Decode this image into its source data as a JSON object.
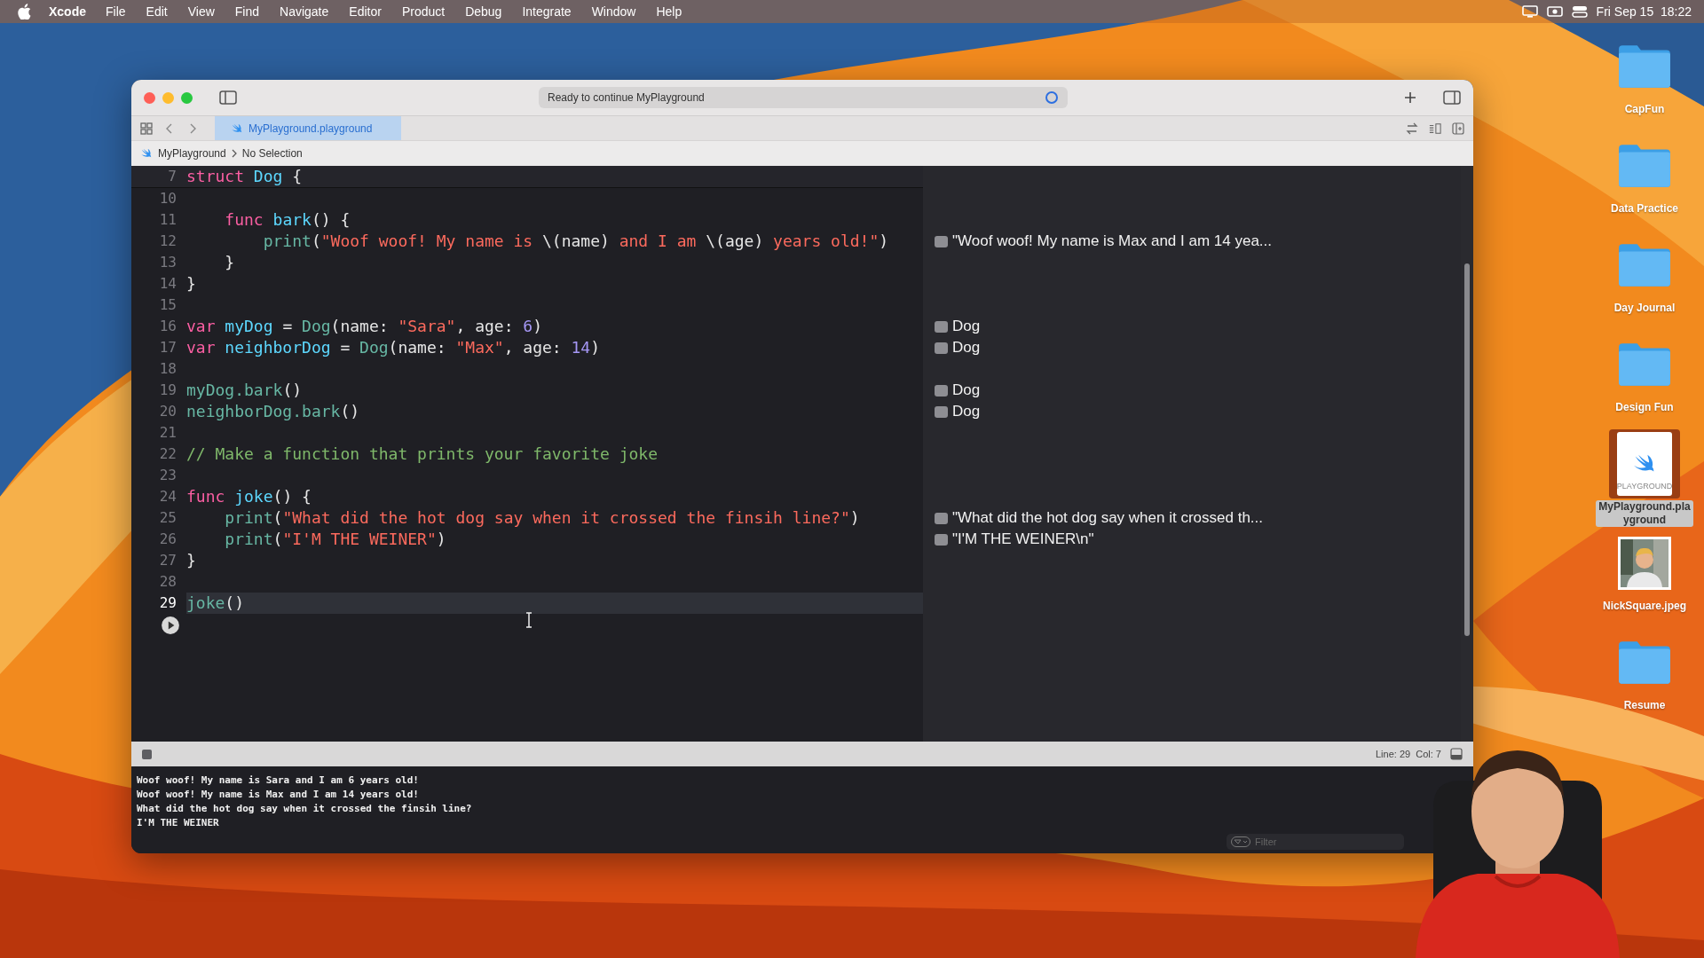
{
  "menu_bar": {
    "app_name": "Xcode",
    "menus": [
      "File",
      "Edit",
      "View",
      "Find",
      "Navigate",
      "Editor",
      "Product",
      "Debug",
      "Integrate",
      "Window",
      "Help"
    ],
    "clock": "Fri Sep 15  18:22"
  },
  "window": {
    "status": "Ready to continue MyPlayground",
    "tabs": [
      {
        "label": "MyPlayground.playground",
        "selected": true
      }
    ],
    "breadcrumb": [
      "MyPlayground",
      "No Selection"
    ],
    "sticky_line": {
      "number": "7",
      "tokens": [
        {
          "kind": "keyword",
          "text": "struct"
        },
        {
          "kind": "decl",
          "text": " Dog"
        },
        {
          "kind": "plain",
          "text": " {"
        }
      ]
    },
    "lines": [
      {
        "number": "10",
        "current": false
      },
      {
        "number": "11",
        "current": false,
        "tokens": [
          {
            "kind": "keyword",
            "text": "    func"
          },
          {
            "kind": "decl",
            "text": " bark"
          },
          {
            "kind": "plain",
            "text": "() {"
          }
        ]
      },
      {
        "number": "12",
        "current": false,
        "result": "\"Woof woof! My name is Max and I am 14 yea...",
        "tokens": [
          {
            "kind": "call",
            "text": "        print"
          },
          {
            "kind": "plain",
            "text": "("
          },
          {
            "kind": "string",
            "text": "\"Woof woof! My name is "
          },
          {
            "kind": "plain",
            "text": "\\(name)"
          },
          {
            "kind": "string",
            "text": " and I am "
          },
          {
            "kind": "plain",
            "text": "\\(age)"
          },
          {
            "kind": "string",
            "text": " years old!\""
          },
          {
            "kind": "plain",
            "text": ")"
          }
        ]
      },
      {
        "number": "13",
        "current": false,
        "tokens": [
          {
            "kind": "plain",
            "text": "    }"
          }
        ]
      },
      {
        "number": "14",
        "current": false,
        "tokens": [
          {
            "kind": "plain",
            "text": "}"
          }
        ]
      },
      {
        "number": "15",
        "current": false
      },
      {
        "number": "16",
        "current": false,
        "result": "Dog",
        "tokens": [
          {
            "kind": "keyword",
            "text": "var"
          },
          {
            "kind": "decl",
            "text": " myDog"
          },
          {
            "kind": "plain",
            "text": " = "
          },
          {
            "kind": "call",
            "text": "Dog"
          },
          {
            "kind": "plain",
            "text": "(name: "
          },
          {
            "kind": "string",
            "text": "\"Sara\""
          },
          {
            "kind": "plain",
            "text": ", age: "
          },
          {
            "kind": "number",
            "text": "6"
          },
          {
            "kind": "plain",
            "text": ")"
          }
        ]
      },
      {
        "number": "17",
        "current": false,
        "result": "Dog",
        "tokens": [
          {
            "kind": "keyword",
            "text": "var"
          },
          {
            "kind": "decl",
            "text": " neighborDog"
          },
          {
            "kind": "plain",
            "text": " = "
          },
          {
            "kind": "call",
            "text": "Dog"
          },
          {
            "kind": "plain",
            "text": "(name: "
          },
          {
            "kind": "string",
            "text": "\"Max\""
          },
          {
            "kind": "plain",
            "text": ", age: "
          },
          {
            "kind": "number",
            "text": "14"
          },
          {
            "kind": "plain",
            "text": ")"
          }
        ]
      },
      {
        "number": "18",
        "current": false
      },
      {
        "number": "19",
        "current": false,
        "result": "Dog",
        "tokens": [
          {
            "kind": "call",
            "text": "myDog.bark"
          },
          {
            "kind": "plain",
            "text": "()"
          }
        ]
      },
      {
        "number": "20",
        "current": false,
        "result": "Dog",
        "tokens": [
          {
            "kind": "call",
            "text": "neighborDog.bark"
          },
          {
            "kind": "plain",
            "text": "()"
          }
        ]
      },
      {
        "number": "21",
        "current": false
      },
      {
        "number": "22",
        "current": false,
        "tokens": [
          {
            "kind": "comment",
            "text": "// Make a function that prints your favorite joke"
          }
        ]
      },
      {
        "number": "23",
        "current": false
      },
      {
        "number": "24",
        "current": false,
        "tokens": [
          {
            "kind": "keyword",
            "text": "func"
          },
          {
            "kind": "decl",
            "text": " joke"
          },
          {
            "kind": "plain",
            "text": "() {"
          }
        ]
      },
      {
        "number": "25",
        "current": false,
        "result": "\"What did the hot dog say when it crossed th...",
        "tokens": [
          {
            "kind": "call",
            "text": "    print"
          },
          {
            "kind": "plain",
            "text": "("
          },
          {
            "kind": "string",
            "text": "\"What did the hot dog say when it crossed the finsih line?\""
          },
          {
            "kind": "plain",
            "text": ")"
          }
        ]
      },
      {
        "number": "26",
        "current": false,
        "result": "\"I'M THE WEINER\\n\"",
        "tokens": [
          {
            "kind": "call",
            "text": "    print"
          },
          {
            "kind": "plain",
            "text": "("
          },
          {
            "kind": "string",
            "text": "\"I'M THE WEINER\""
          },
          {
            "kind": "plain",
            "text": ")"
          }
        ]
      },
      {
        "number": "27",
        "current": false,
        "tokens": [
          {
            "kind": "plain",
            "text": "}"
          }
        ]
      },
      {
        "number": "28",
        "current": false
      },
      {
        "number": "29",
        "current": true,
        "tokens": [
          {
            "kind": "call",
            "text": "joke"
          },
          {
            "kind": "plain",
            "text": "()"
          }
        ]
      }
    ],
    "cursor_position": "Line: 29  Col: 7",
    "console": [
      "Woof woof! My name is Sara and I am 6 years old!",
      "Woof woof! My name is Max and I am 14 years old!",
      "What did the hot dog say when it crossed the finsih line?",
      "I'M THE WEINER"
    ],
    "filter": {
      "placeholder": "Filter"
    }
  },
  "desktop_icons": [
    {
      "label": "CapFun",
      "kind": "folder",
      "selected": false
    },
    {
      "label": "Data Practice",
      "kind": "folder",
      "selected": false
    },
    {
      "label": "Day Journal",
      "kind": "folder",
      "selected": false
    },
    {
      "label": "Design Fun",
      "kind": "folder",
      "selected": false
    },
    {
      "label": "MyPlayground.playground",
      "kind": "playground",
      "selected": true,
      "icon_label": "PLAYGROUND"
    },
    {
      "label": "NickSquare.jpeg",
      "selected": false
    },
    {
      "label": "Resume",
      "kind": "folder",
      "selected": false
    }
  ]
}
